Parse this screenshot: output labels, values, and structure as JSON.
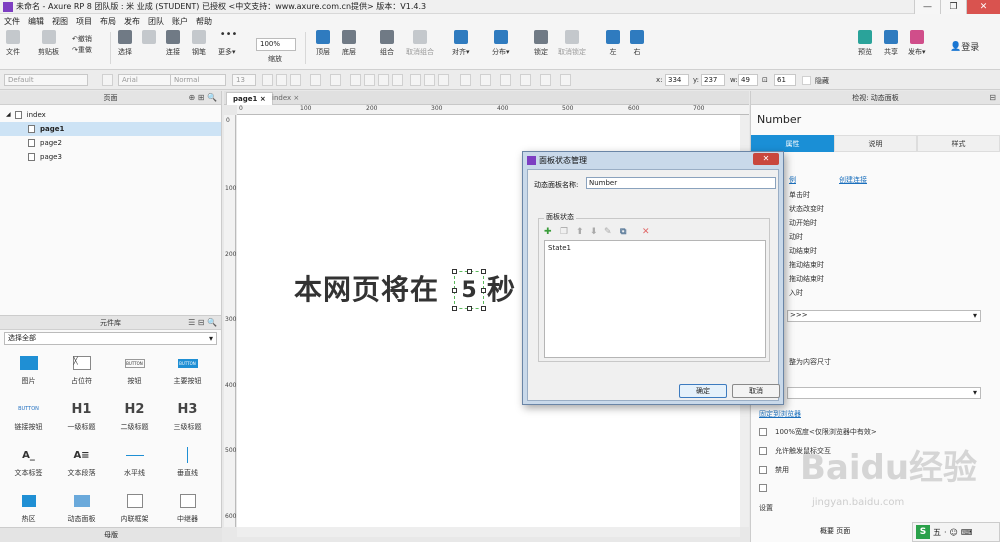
{
  "window": {
    "title": "未命名 - Axure RP 8 团队版 : 米 业成 (STUDENT) 已授权    <中文支持：www.axure.com.cn提供> 版本：V1.4.3"
  },
  "menu": [
    "文件",
    "编辑",
    "视图",
    "项目",
    "布局",
    "发布",
    "团队",
    "账户",
    "帮助"
  ],
  "toolbar": {
    "file": "文件",
    "clipboard": "剪贴板",
    "undo": "撤销",
    "redo": "重做",
    "select": "选择",
    "connect": "连接",
    "pen": "钢笔",
    "more": "更多▾",
    "zoom_value": "100%",
    "zoom_label": "缩放",
    "front": "顶层",
    "back": "底层",
    "group": "组合",
    "ungroup": "取消组合",
    "align": "对齐▾",
    "distribute": "分布▾",
    "lock": "锁定",
    "unlock": "取消锁定",
    "left": "左",
    "right": "右",
    "preview": "预览",
    "share": "共享",
    "publish": "发布▾",
    "login": "登录"
  },
  "formatbar": {
    "style": "Default",
    "font": "Arial",
    "weight": "Normal",
    "size": "13",
    "x_label": "x:",
    "x": "334",
    "y_label": "y:",
    "y": "237",
    "w_label": "w:",
    "w": "49",
    "h": "61",
    "hidden": "隐藏"
  },
  "pages_panel": {
    "title": "页面",
    "root": "index",
    "pages": [
      "page1",
      "page2",
      "page3"
    ],
    "selected": "page1"
  },
  "library": {
    "title": "元件库",
    "filter": "选择全部",
    "items": [
      {
        "label": "图片",
        "icon": "image-icon"
      },
      {
        "label": "占位符",
        "icon": "placeholder-icon"
      },
      {
        "label": "按钮",
        "icon": "button-icon",
        "glyph": "BUTTON"
      },
      {
        "label": "主要按钮",
        "icon": "primary-button-icon",
        "glyph": "BUTTON"
      },
      {
        "label": "链接按钮",
        "icon": "link-button-icon",
        "glyph": "BUTTON"
      },
      {
        "label": "一级标题",
        "icon": "h1-icon",
        "glyph": "H1"
      },
      {
        "label": "二级标题",
        "icon": "h2-icon",
        "glyph": "H2"
      },
      {
        "label": "三级标题",
        "icon": "h3-icon",
        "glyph": "H3"
      },
      {
        "label": "文本标签",
        "icon": "text-label-icon",
        "glyph": "A_"
      },
      {
        "label": "文本段落",
        "icon": "paragraph-icon",
        "glyph": "A≡"
      },
      {
        "label": "水平线",
        "icon": "hline-icon"
      },
      {
        "label": "垂直线",
        "icon": "vline-icon"
      },
      {
        "label": "热区",
        "icon": "hotspot-icon"
      },
      {
        "label": "动态面板",
        "icon": "dynamic-panel-icon"
      },
      {
        "label": "内联框架",
        "icon": "inline-frame-icon"
      },
      {
        "label": "中继器",
        "icon": "repeater-icon"
      }
    ]
  },
  "master": {
    "title": "母版"
  },
  "tabs": [
    {
      "label": "page1"
    },
    {
      "label": "index"
    }
  ],
  "ruler": {
    "h": [
      "0",
      "100",
      "200",
      "300",
      "400",
      "500",
      "600",
      "700"
    ],
    "v": [
      "0",
      "100",
      "200",
      "300",
      "400",
      "500",
      "600"
    ]
  },
  "canvas": {
    "text": "本网页将在",
    "number": "5",
    "suffix": "秒"
  },
  "right_panel": {
    "header": "检视: 动态面板",
    "name": "Number",
    "tabs": [
      "属性",
      "说明",
      "样式"
    ],
    "create_link": "创建连接",
    "example": "例",
    "events": [
      "单击时",
      "状态改变时",
      "动开始时",
      "动时",
      "动结束时",
      "拖动结束时",
      "拖动结束时",
      "入时"
    ],
    "more": ">>>",
    "fit": "整为内容尺寸",
    "pin": "固定到浏览器",
    "opt1": "100%宽度<仅限浏览器中有效>",
    "opt2": "允许触发鼠标交互",
    "opt3": "禁用",
    "setting": "设置",
    "footer": "概要  页面"
  },
  "dialog": {
    "title": "面板状态管理",
    "name_label": "动态面板名称:",
    "name_value": "Number",
    "group_label": "面板状态",
    "states": [
      "State1"
    ],
    "ok": "确定",
    "cancel": "取消"
  },
  "taskbar": {
    "ime": "五",
    "items": [
      "·",
      "☺",
      "⌨"
    ]
  },
  "watermark": {
    "brand": "Baidu经验",
    "url": "jingyan.baidu.com"
  }
}
